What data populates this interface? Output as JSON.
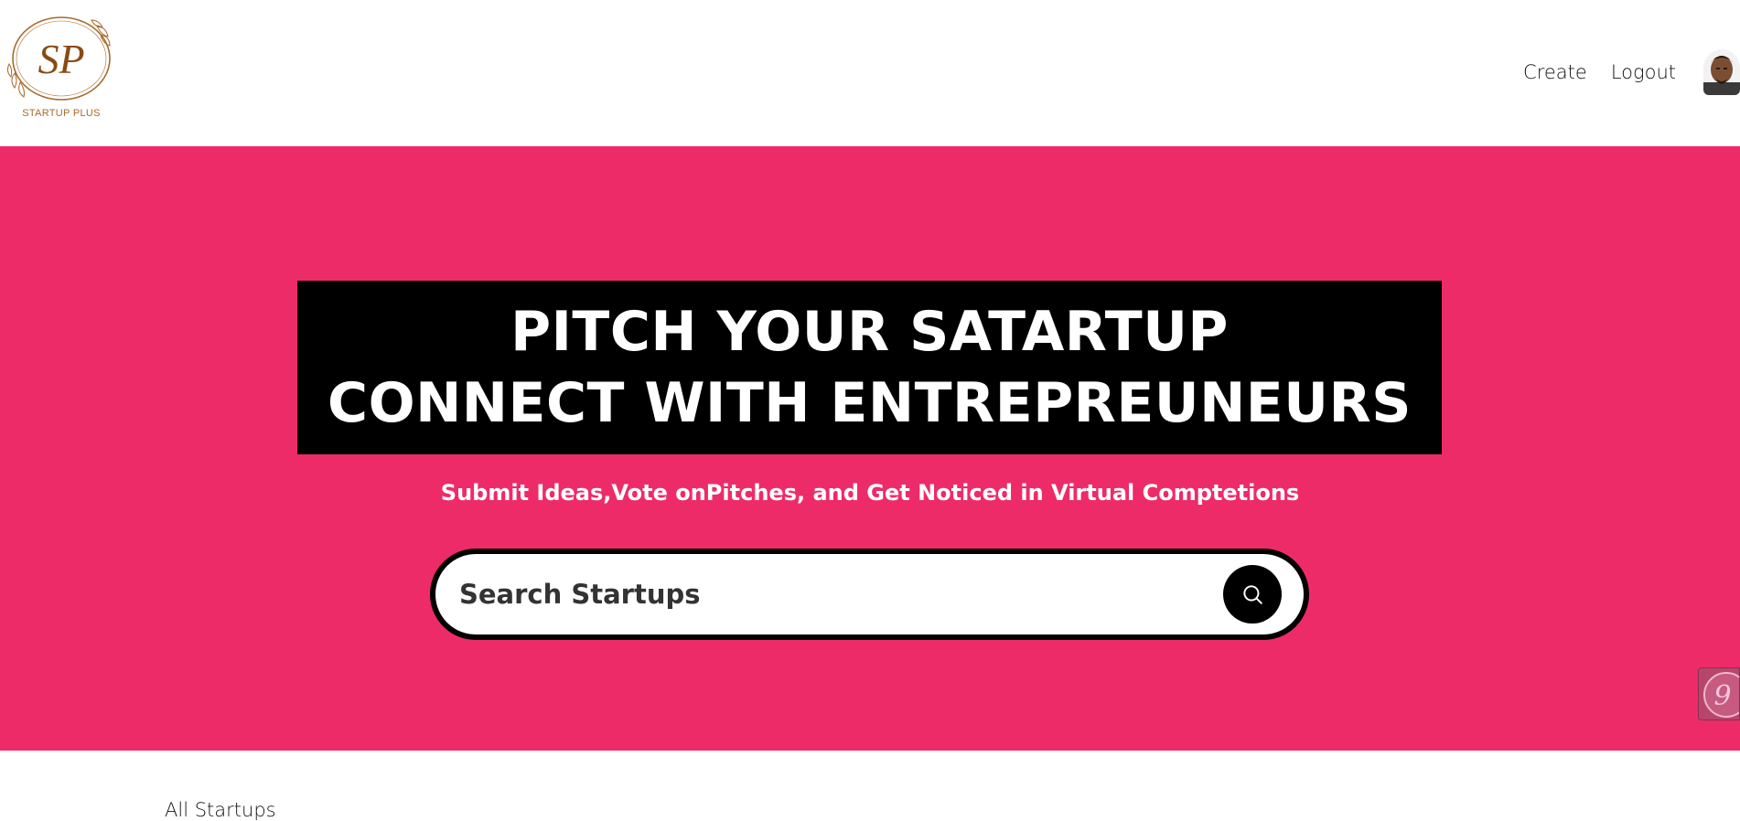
{
  "brand": {
    "logo_text": "STARTUP PLUS",
    "logo_monogram": "SP",
    "accent_color": "#a86a2a"
  },
  "nav": {
    "create_label": "Create",
    "logout_label": "Logout"
  },
  "hero": {
    "background_color": "#ee2b69",
    "headline_line1": "PITCH YOUR SATARTUP",
    "headline_line2": "CONNECT WITH ENTREPREUNEURS",
    "subheading": "Submit Ideas,Vote onPitches, and Get Noticed in Virtual Comptetions"
  },
  "search": {
    "placeholder": "Search Startups",
    "button_icon": "search-icon"
  },
  "section": {
    "title": "All Startups"
  },
  "icons": {
    "avatar": "user-avatar",
    "widget": "chat-widget-icon"
  }
}
